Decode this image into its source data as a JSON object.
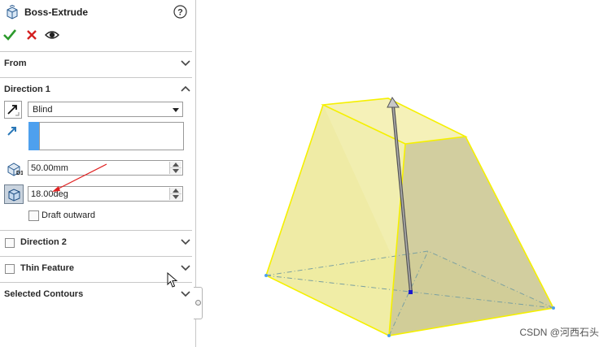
{
  "feature": {
    "title": "Boss-Extrude",
    "title_icon": "boss-extrude-icon",
    "help_icon": "help-icon"
  },
  "actions": {
    "ok_icon": "checkmark-icon",
    "cancel_icon": "close-icon",
    "preview_icon": "eye-icon"
  },
  "sections": {
    "from": {
      "label": "From",
      "expanded": false
    },
    "direction1": {
      "label": "Direction 1",
      "expanded": true
    },
    "direction2": {
      "label": "Direction 2",
      "expanded": false,
      "checked": false
    },
    "thin_feature": {
      "label": "Thin Feature",
      "expanded": false,
      "checked": false
    },
    "selected_contours": {
      "label": "Selected Contours",
      "expanded": false
    }
  },
  "direction1": {
    "end_condition": "Blind",
    "depth": "50.00mm",
    "draft_angle": "18.00deg",
    "draft_outward_label": "Draft outward",
    "draft_outward_checked": false
  },
  "colors": {
    "ok_green": "#2c9a2c",
    "cancel_red": "#d42020",
    "face_yellow": "#f2ec9c",
    "edge_yellow": "#f5f000",
    "selection_blue": "#4ea0ee",
    "annotation_red": "#e02020"
  },
  "watermark": "CSDN @河西石头"
}
